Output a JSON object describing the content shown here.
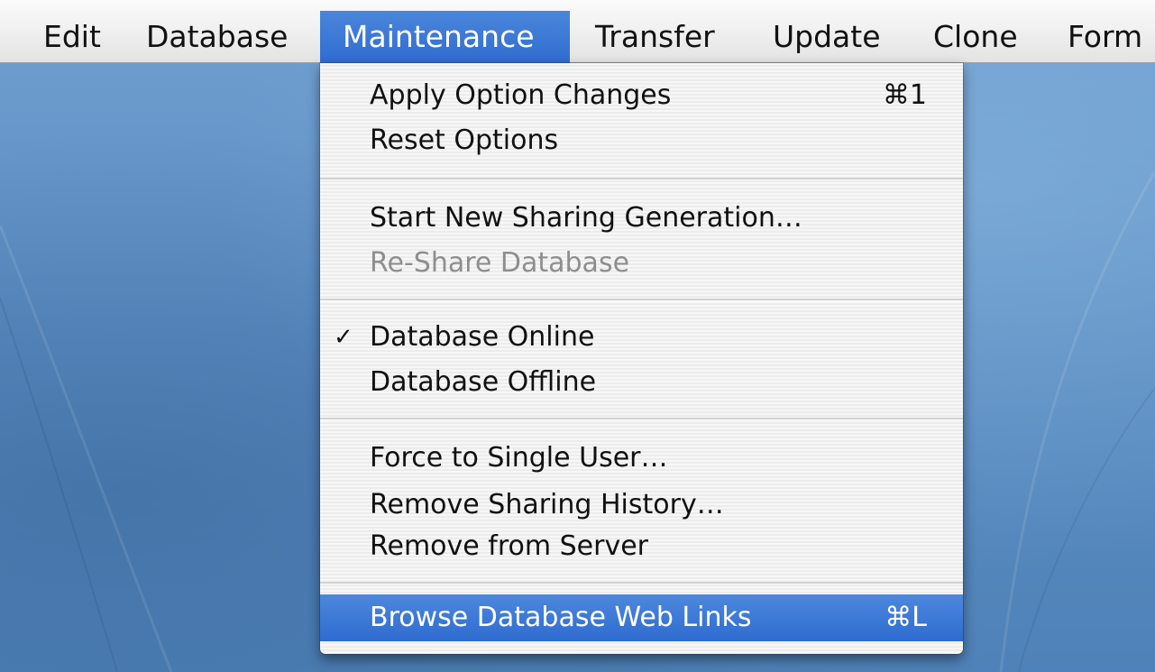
{
  "menubar": {
    "items": [
      "Edit",
      "Database",
      "Maintenance",
      "Transfer",
      "Update",
      "Clone",
      "Form"
    ],
    "open_menu": "Maintenance"
  },
  "maintenance_menu": {
    "apply_option_changes": {
      "label": "Apply Option Changes",
      "shortcut": "⌘1"
    },
    "reset_options": {
      "label": "Reset Options"
    },
    "start_new_sharing_generation": {
      "label": "Start New Sharing Generation…"
    },
    "re_share_database": {
      "label": "Re-Share Database",
      "enabled": false
    },
    "database_online": {
      "label": "Database Online",
      "checked": true,
      "check_glyph": "✓"
    },
    "database_offline": {
      "label": "Database Offline"
    },
    "force_to_single_user": {
      "label": "Force to Single User…"
    },
    "remove_sharing_history": {
      "label": "Remove Sharing History…"
    },
    "remove_from_server": {
      "label": "Remove from Server"
    },
    "browse_database_web_links": {
      "label": "Browse Database Web Links",
      "shortcut": "⌘L",
      "highlighted": true
    }
  },
  "colors": {
    "selection": "#3a77d6",
    "menu_background": "#f2f2f2",
    "desktop": "#5a8cc0",
    "disabled_text": "#8e8e8e"
  }
}
